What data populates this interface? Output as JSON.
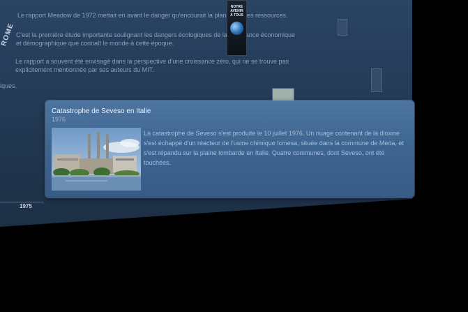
{
  "background": {
    "logo_text": "ROME",
    "paragraphs": [
      "Le rapport Meadow de 1972 mettait en avant le danger qu'encourait la planète et ses ressources.",
      "C'est la première étude importante soulignant les dangers écologiques de la croissance économique",
      "et démographique que connaît le monde à cette époque.",
      "Le rapport a souvent été envisagé dans la perspective d'une croissance zéro, qui ne se trouve pas",
      "explicitement mentionnée par ses auteurs du MIT.",
      "iques."
    ],
    "book_title": "NOTRE AVENIR À TOUS",
    "timeline_year": "1975"
  },
  "card": {
    "title": "Catastrophe de Seveso en Italie",
    "year": "1976",
    "body": "La catastrophe de Seveso s'est produite le 10 juillet 1976. Un nuage contenant de la dioxine s'est échappé d'un réacteur de l'usine chimique Icmesa, située dans la commune de Meda, et s'est répandu sur la plaine lombarde en Italie. Quatre communes, dont Seveso, ont été touchées."
  },
  "colors": {
    "card": "#3f6591",
    "background_surface": "#22354d",
    "page": "#000000"
  }
}
